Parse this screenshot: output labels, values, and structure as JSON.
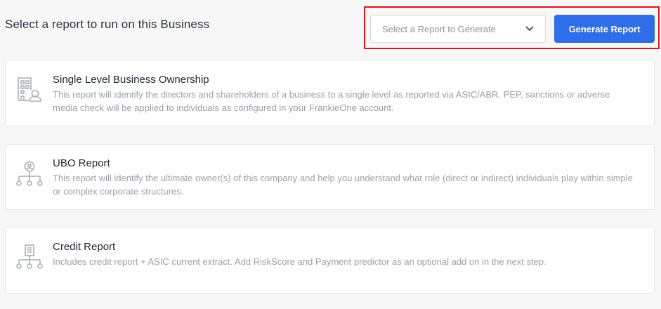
{
  "header": {
    "title": "Select a report to run on this Business",
    "select_placeholder": "Select a Report to Generate",
    "generate_label": "Generate Report"
  },
  "reports": [
    {
      "icon": "building-person-icon",
      "title": "Single Level Business Ownership",
      "description": "This report will identify the directors and shareholders of a business to a single level as reported via ASIC/ABR. PEP, sanctions or adverse media check will be applied to individuals as configured in your FrankieOne account."
    },
    {
      "icon": "ownership-tree-icon",
      "title": "UBO Report",
      "description": "This report will identify the ultimate owner(s) of this company and help you understand what role (direct or indirect) individuals play within simple or complex corporate structures."
    },
    {
      "icon": "document-tree-icon",
      "title": "Credit Report",
      "description": "Includes credit report + ASIC current extract. Add RiskScore and Payment predictor as an optional add on in the next step."
    }
  ],
  "colors": {
    "primary_button": "#2f6ee8",
    "highlight_border": "#e3121b",
    "icon_gray": "#a9aeb6"
  }
}
